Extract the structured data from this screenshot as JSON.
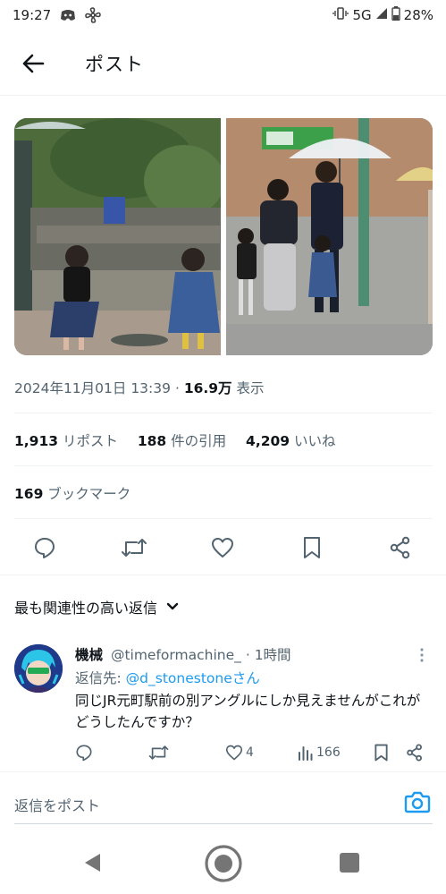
{
  "status_bar": {
    "time": "19:27",
    "network": "5G",
    "battery": "28%",
    "icons": [
      "discord-icon",
      "pinwheel-icon",
      "vibrate-icon",
      "signal-icon",
      "battery-icon"
    ]
  },
  "header": {
    "title": "ポスト",
    "back_icon": "arrow-left-icon"
  },
  "media": {
    "photos": [
      "left-photo-children-in-plaza",
      "right-photo-man-with-umbrella-greeting-woman-and-child"
    ]
  },
  "post": {
    "timestamp": "2024年11月01日 13:39",
    "separator": "·",
    "views_count": "16.9万",
    "views_label": "表示",
    "reposts_count": "1,913",
    "reposts_label": "リポスト",
    "quotes_count": "188",
    "quotes_label": "件の引用",
    "likes_count": "4,209",
    "likes_label": "いいね",
    "bookmarks_count": "169",
    "bookmarks_label": "ブックマーク"
  },
  "actions": [
    "reply-icon",
    "repost-icon",
    "like-icon",
    "bookmark-icon",
    "share-icon"
  ],
  "replies_sort": {
    "label": "最も関連性の高い返信"
  },
  "reply": {
    "display_name": "機械",
    "handle": "@timeformachine_",
    "dot": "·",
    "time": "1時間",
    "reply_to_label": "返信先:",
    "reply_to_handle": "@d_stonestone",
    "reply_to_suffix": "さん",
    "text": "同じJR元町駅前の別アングルにしか見えませんがこれがどうしたんですか？",
    "likes": "4",
    "views": "166"
  },
  "compose": {
    "placeholder": "返信をポスト"
  },
  "colors": {
    "accent": "#1d9bf0",
    "text_primary": "#0f1419",
    "text_secondary": "#536471",
    "divider": "#eff3f4"
  }
}
